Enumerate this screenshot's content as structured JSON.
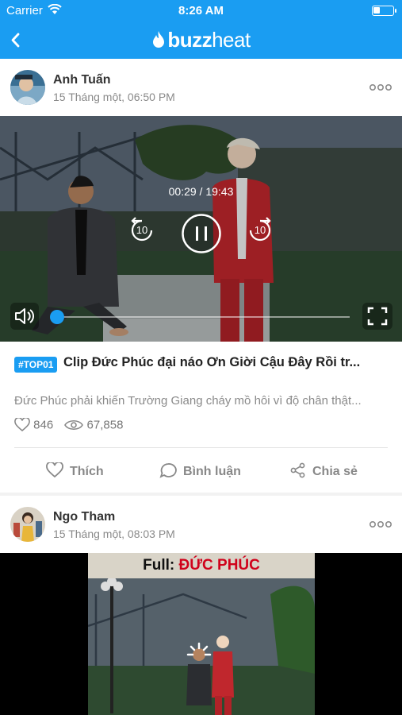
{
  "status_bar": {
    "carrier": "Carrier",
    "time": "8:26 AM",
    "battery_level": 0.35
  },
  "nav": {
    "logo_prefix": "buzz",
    "logo_suffix": "heat",
    "back_icon": "chevron-left-icon"
  },
  "posts": [
    {
      "author": "Anh Tuấn",
      "date": "15 Tháng một, 06:50 PM",
      "video_time": "00:29 / 19:43",
      "rewind_label": "10",
      "forward_label": "10",
      "progress": 0.01,
      "tag": "#TOP01",
      "title": "Clip Đức Phúc đại náo Ơn Giời Cậu Đây Rồi  tr...",
      "description": "Đức Phúc phải khiến Trường Giang cháy mồ hôi vì độ chân thật...",
      "likes": "846",
      "views": "67,858"
    },
    {
      "author": "Ngo Tham",
      "date": "15 Tháng một, 08:03 PM",
      "thumbnail_caption_prefix": "Full: ",
      "thumbnail_caption_highlight": "ĐỨC PHÚC"
    }
  ],
  "actions": {
    "like": "Thích",
    "comment": "Bình luận",
    "share": "Chia sẻ"
  },
  "colors": {
    "accent": "#1a9df2",
    "caption_red": "#d0021b"
  }
}
